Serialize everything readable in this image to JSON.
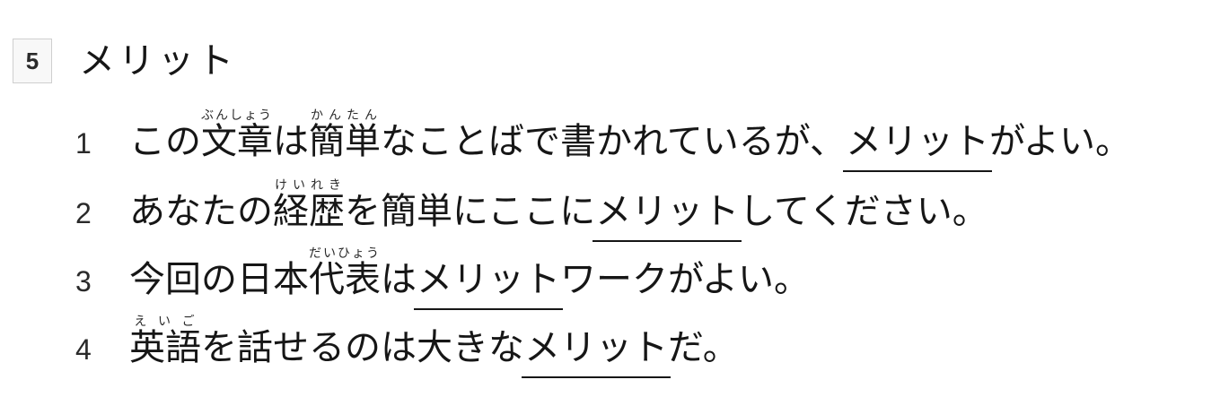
{
  "question": {
    "number": "5",
    "word": "メリット"
  },
  "options": [
    {
      "number": "1",
      "parts": {
        "p1": "この",
        "r1_base": "文章",
        "r1_ruby": "ぶんしょう",
        "p2": "は",
        "r2_base": "簡単",
        "r2_ruby": "かんたん",
        "p3": "なことばで書かれているが、",
        "target": "メリット",
        "p4": "がよい。"
      }
    },
    {
      "number": "2",
      "parts": {
        "p1": "あなたの",
        "r1_base": "経歴",
        "r1_ruby": "けいれき",
        "p2": "を簡単にここに",
        "target": "メリット",
        "p3": "してください。"
      }
    },
    {
      "number": "3",
      "parts": {
        "p1": "今回の日本",
        "r1_base": "代表",
        "r1_ruby": "だいひょう",
        "p2": "は",
        "target": "メリット",
        "p3": "ワークがよい。"
      }
    },
    {
      "number": "4",
      "parts": {
        "r1_base": "英語",
        "r1_ruby": "えいご",
        "p1": "を話せるのは大きな",
        "target": "メリット",
        "p2": "だ。"
      }
    }
  ]
}
